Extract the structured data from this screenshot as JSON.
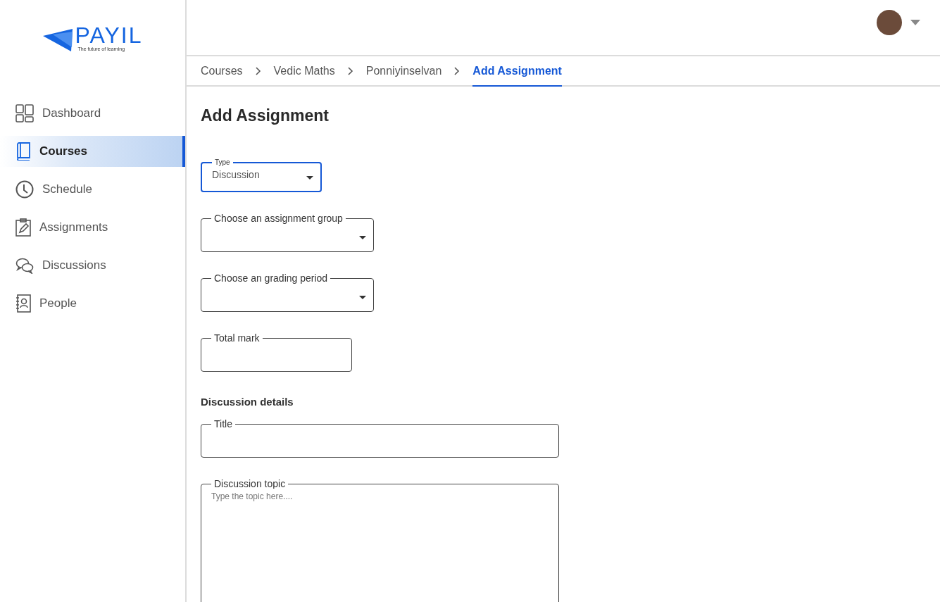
{
  "logo": {
    "name": "PAYIL",
    "tagline": "The future of learning"
  },
  "sidebar": {
    "items": [
      {
        "label": "Dashboard",
        "selected": false
      },
      {
        "label": "Courses",
        "selected": true
      },
      {
        "label": "Schedule",
        "selected": false
      },
      {
        "label": "Assignments",
        "selected": false
      },
      {
        "label": "Discussions",
        "selected": false
      },
      {
        "label": "People",
        "selected": false
      }
    ]
  },
  "breadcrumb": [
    {
      "label": "Courses",
      "selected": false
    },
    {
      "label": "Vedic Maths",
      "selected": false
    },
    {
      "label": "Ponniyinselvan",
      "selected": false
    },
    {
      "label": "Add Assignment",
      "selected": true
    }
  ],
  "page_title": "Add Assignment",
  "form": {
    "fields": [
      {
        "kind": "select",
        "label": "Type",
        "value": "Discussion",
        "focused": true
      },
      {
        "kind": "select",
        "label": "Choose an assignment group",
        "focused": false
      },
      {
        "kind": "select",
        "label": "Choose an grading period",
        "focused": false
      },
      {
        "kind": "input",
        "label": "Total mark",
        "focused": false
      }
    ],
    "section_title": "Discussion details",
    "details": [
      {
        "kind": "input",
        "label": "Title",
        "focused": false
      },
      {
        "kind": "textarea",
        "label": "Discussion topic",
        "placeholder": "Type the topic here....",
        "focused": false
      }
    ]
  }
}
